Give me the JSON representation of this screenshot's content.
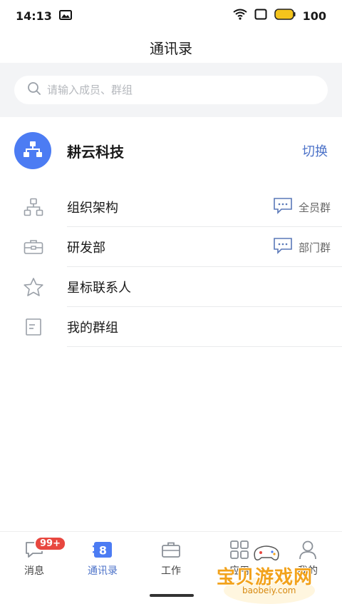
{
  "status": {
    "time": "14:13",
    "battery": "100"
  },
  "header": {
    "title": "通讯录"
  },
  "search": {
    "placeholder": "请输入成员、群组"
  },
  "org": {
    "name": "耕云科技",
    "switch_label": "切换"
  },
  "list": [
    {
      "label": "组织架构",
      "group": "全员群",
      "icon": "org-tree-icon"
    },
    {
      "label": "研发部",
      "group": "部门群",
      "icon": "briefcase-icon"
    },
    {
      "label": "星标联系人",
      "icon": "star-icon"
    },
    {
      "label": "我的群组",
      "icon": "document-icon"
    }
  ],
  "tabs": [
    {
      "label": "消息",
      "badge": "99+",
      "icon": "chat-icon"
    },
    {
      "label": "通讯录",
      "active": true,
      "icon": "contacts-icon"
    },
    {
      "label": "工作",
      "icon": "briefcase-icon"
    },
    {
      "label": "应用",
      "icon": "grid-icon"
    },
    {
      "label": "我的",
      "icon": "user-icon"
    }
  ],
  "watermark": {
    "text": "宝贝游戏网",
    "url": "baobeiy.com"
  },
  "colors": {
    "accent": "#4c7cf3",
    "link": "#4c72c8",
    "badge": "#e8473f"
  }
}
